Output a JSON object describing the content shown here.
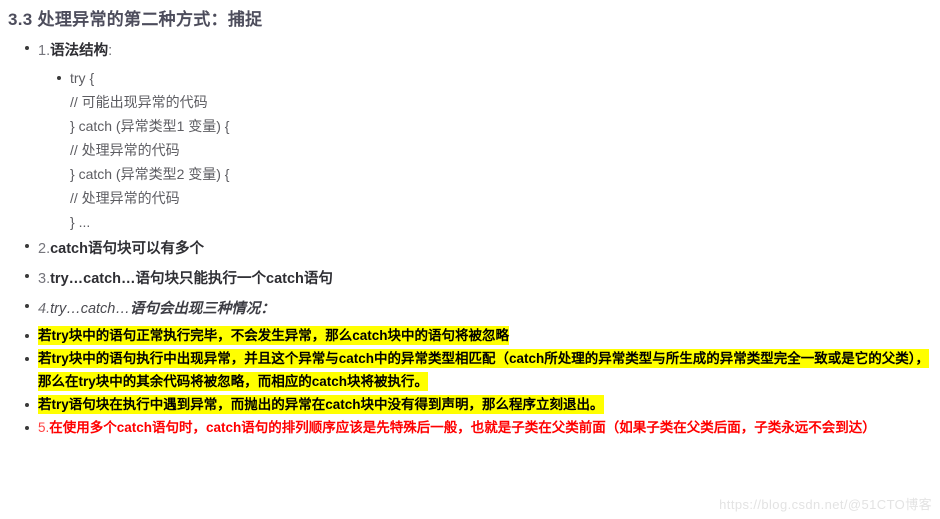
{
  "document": {
    "title": "3.3 处理异常的第二种方式：捕捉"
  },
  "outline": {
    "item1": {
      "number": "1.",
      "label": "语法结构",
      "colon": ":"
    },
    "code_block": {
      "lines": [
        "try {",
        "// 可能出现异常的代码",
        "} catch (异常类型1 变量) {",
        "// 处理异常的代码",
        "} catch (异常类型2 变量) {",
        "// 处理异常的代码",
        "} ..."
      ]
    },
    "item2": {
      "number": "2.",
      "text": "catch语句块可以有多个"
    },
    "item3": {
      "number": "3.",
      "text": "try…catch…语句块只能执行一个catch语句"
    },
    "item4": {
      "number": "4.",
      "code_part": "try…catch…",
      "text": "语句会出现三种情况："
    },
    "highlight1": {
      "text": "若try块中的语句正常执行完毕，不会发生异常，那么catch块中的语句将被忽略"
    },
    "highlight2": {
      "text": "若try块中的语句执行中出现异常，并且这个异常与catch中的异常类型相匹配（catch所处理的异常类型与所生成的异常类型完全一致或是它的父类），那么在try块中的其余代码将被忽略，而相应的catch块将被执行。"
    },
    "highlight3": {
      "text": "若try语句块在执行中遇到异常，而抛出的异常在catch块中没有得到声明，那么程序立刻退出。"
    },
    "item5": {
      "number": "5.",
      "text": "在使用多个catch语句时，catch语句的排列顺序应该是先特殊后一般，也就是子类在父类前面（如果子类在父类后面，子类永远不会到达）"
    }
  },
  "watermark": {
    "text": "https://blog.csdn.net/@51CTO博客"
  },
  "colors": {
    "highlight": "#ffff00",
    "red_text": "#ff0000",
    "title": "#4d4d5c",
    "body_text": "#3f3f46",
    "code_text": "#5d5d62",
    "watermark": "#e3e3e3"
  }
}
